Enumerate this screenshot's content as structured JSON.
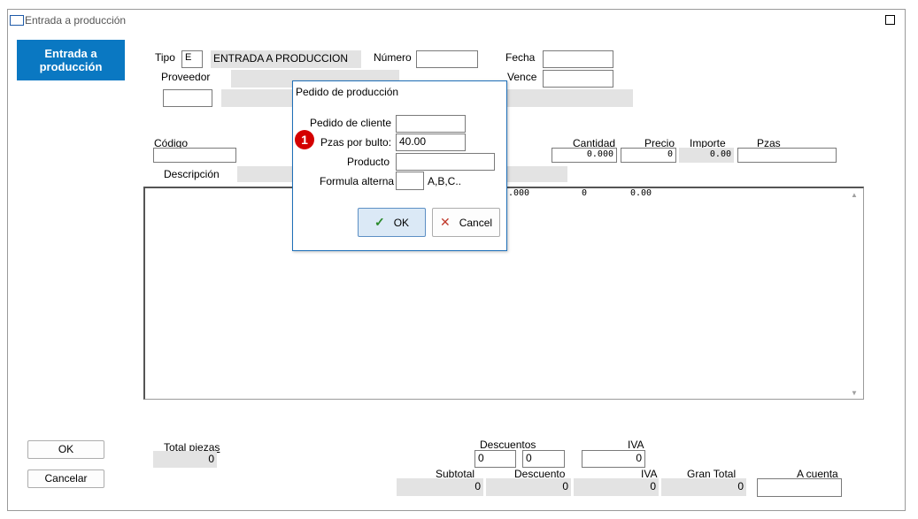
{
  "window": {
    "title": "Entrada a producción"
  },
  "sidebar": {
    "tile_label": "Entrada a producción",
    "ok_label": "OK",
    "cancel_label": "Cancelar"
  },
  "header": {
    "tipo_label": "Tipo",
    "tipo_value": "E",
    "tipo_desc": "ENTRADA A PRODUCCION",
    "numero_label": "Número",
    "numero_value": "",
    "fecha_label": "Fecha",
    "fecha_value": "",
    "vence_label": "Vence",
    "vence_value": "",
    "proveedor_label": "Proveedor",
    "proveedor_value": "",
    "proveedor_code": ""
  },
  "item": {
    "codigo_label": "Código",
    "codigo_value": "",
    "descripcion_label": "Descripción",
    "cantidad_label": "Cantidad",
    "cantidad_value": "0.000",
    "precio_label": "Precio",
    "precio_value": "0",
    "importe_label": "Importe",
    "importe_value": "0.00",
    "pzas_label": "Pzas",
    "pzas_value": ""
  },
  "grid": {
    "row1": [
      ".000",
      "0",
      "0.00"
    ]
  },
  "totals": {
    "total_piezas_label": "Total piezas",
    "total_piezas_value": "0",
    "descuentos_label": "Descuentos",
    "descuento1": "0",
    "descuento2": "0",
    "iva_label": "IVA",
    "iva_input": "0",
    "subtotal_label": "Subtotal",
    "subtotal_value": "0",
    "descuento_label": "Descuento",
    "descuento_value": "0",
    "iva_total_label": "IVA",
    "iva_total_value": "0",
    "gran_total_label": "Gran Total",
    "gran_total_value": "0",
    "a_cuenta_label": "A cuenta",
    "a_cuenta_value": ""
  },
  "dialog": {
    "title": "Pedido de producción",
    "pedido_label": "Pedido de cliente",
    "pedido_value": "",
    "pzas_label": "Pzas por bulto:",
    "pzas_value": "40.00",
    "producto_label": "Producto",
    "producto_value": "",
    "formula_label": "Formula alterna",
    "formula_value": "",
    "formula_hint": "A,B,C..",
    "ok_label": "OK",
    "cancel_label": "Cancel",
    "badge_number": "1"
  },
  "colors": {
    "accent": "#0a78c2",
    "dialog_border": "#1e6fb8",
    "badge": "#d40000",
    "ok_check": "#2a8a2a",
    "cancel_x": "#c0392b"
  }
}
